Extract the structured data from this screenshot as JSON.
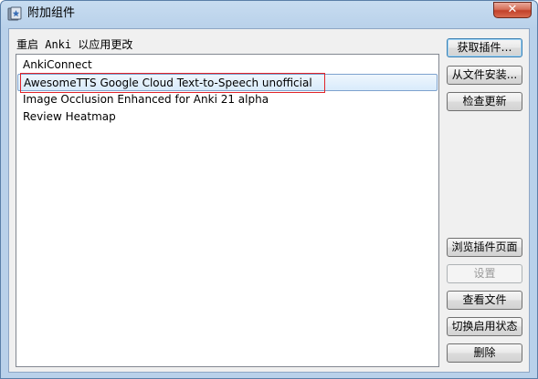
{
  "window": {
    "title": "附加组件",
    "close_label": "✕"
  },
  "hint_text": "重启 Anki 以应用更改",
  "addons": [
    {
      "label": "AnkiConnect",
      "selected": false
    },
    {
      "label": "AwesomeTTS Google Cloud Text-to-Speech unofficial",
      "selected": true
    },
    {
      "label": "Image Occlusion Enhanced for Anki 21 alpha",
      "selected": false
    },
    {
      "label": "Review Heatmap",
      "selected": false
    }
  ],
  "buttons": {
    "get_addons": "获取插件…",
    "install_from_file": "从文件安装...",
    "check_updates": "检查更新",
    "browse_page": "浏览插件页面",
    "config": "设置",
    "view_files": "查看文件",
    "toggle_enabled": "切换启用状态",
    "delete": "删除"
  },
  "colors": {
    "highlight_border": "#e0242a",
    "selection_border": "#7da2ce"
  }
}
